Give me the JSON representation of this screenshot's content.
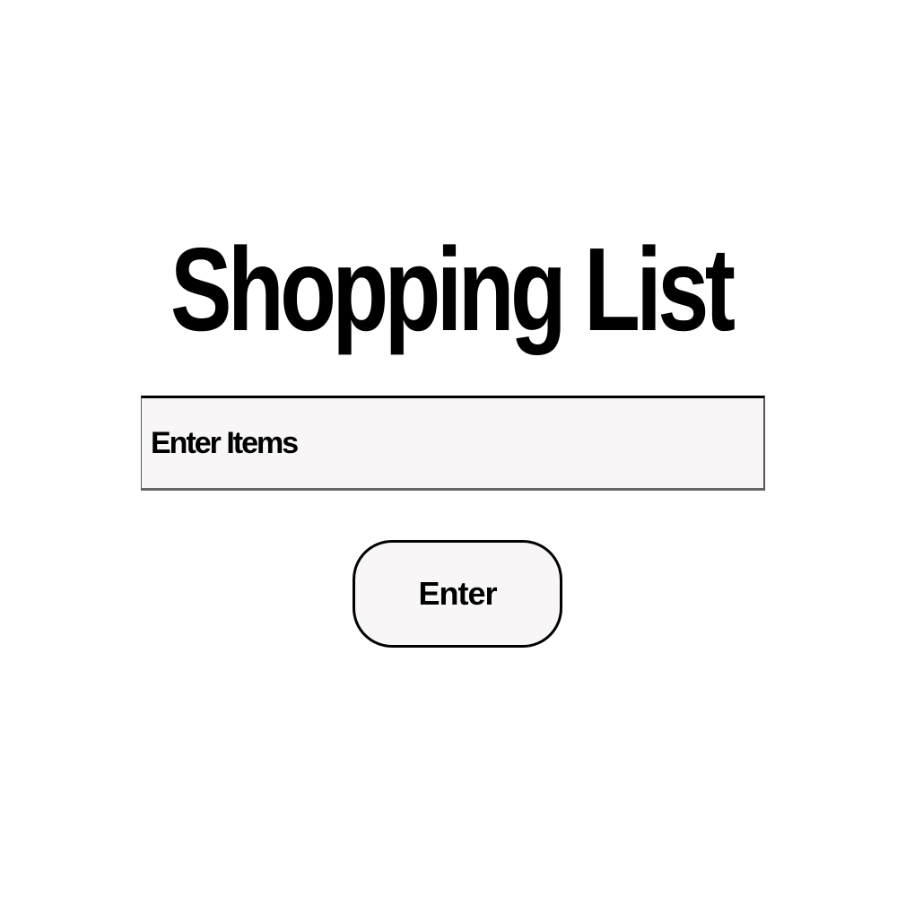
{
  "header": {
    "title": "Shopping List"
  },
  "form": {
    "items_input": {
      "placeholder": "Enter Items",
      "value": ""
    },
    "enter_button_label": "Enter"
  },
  "colors": {
    "text": "#000000",
    "background": "#ffffff",
    "field_background": "#f8f6f6",
    "border": "#000000"
  }
}
